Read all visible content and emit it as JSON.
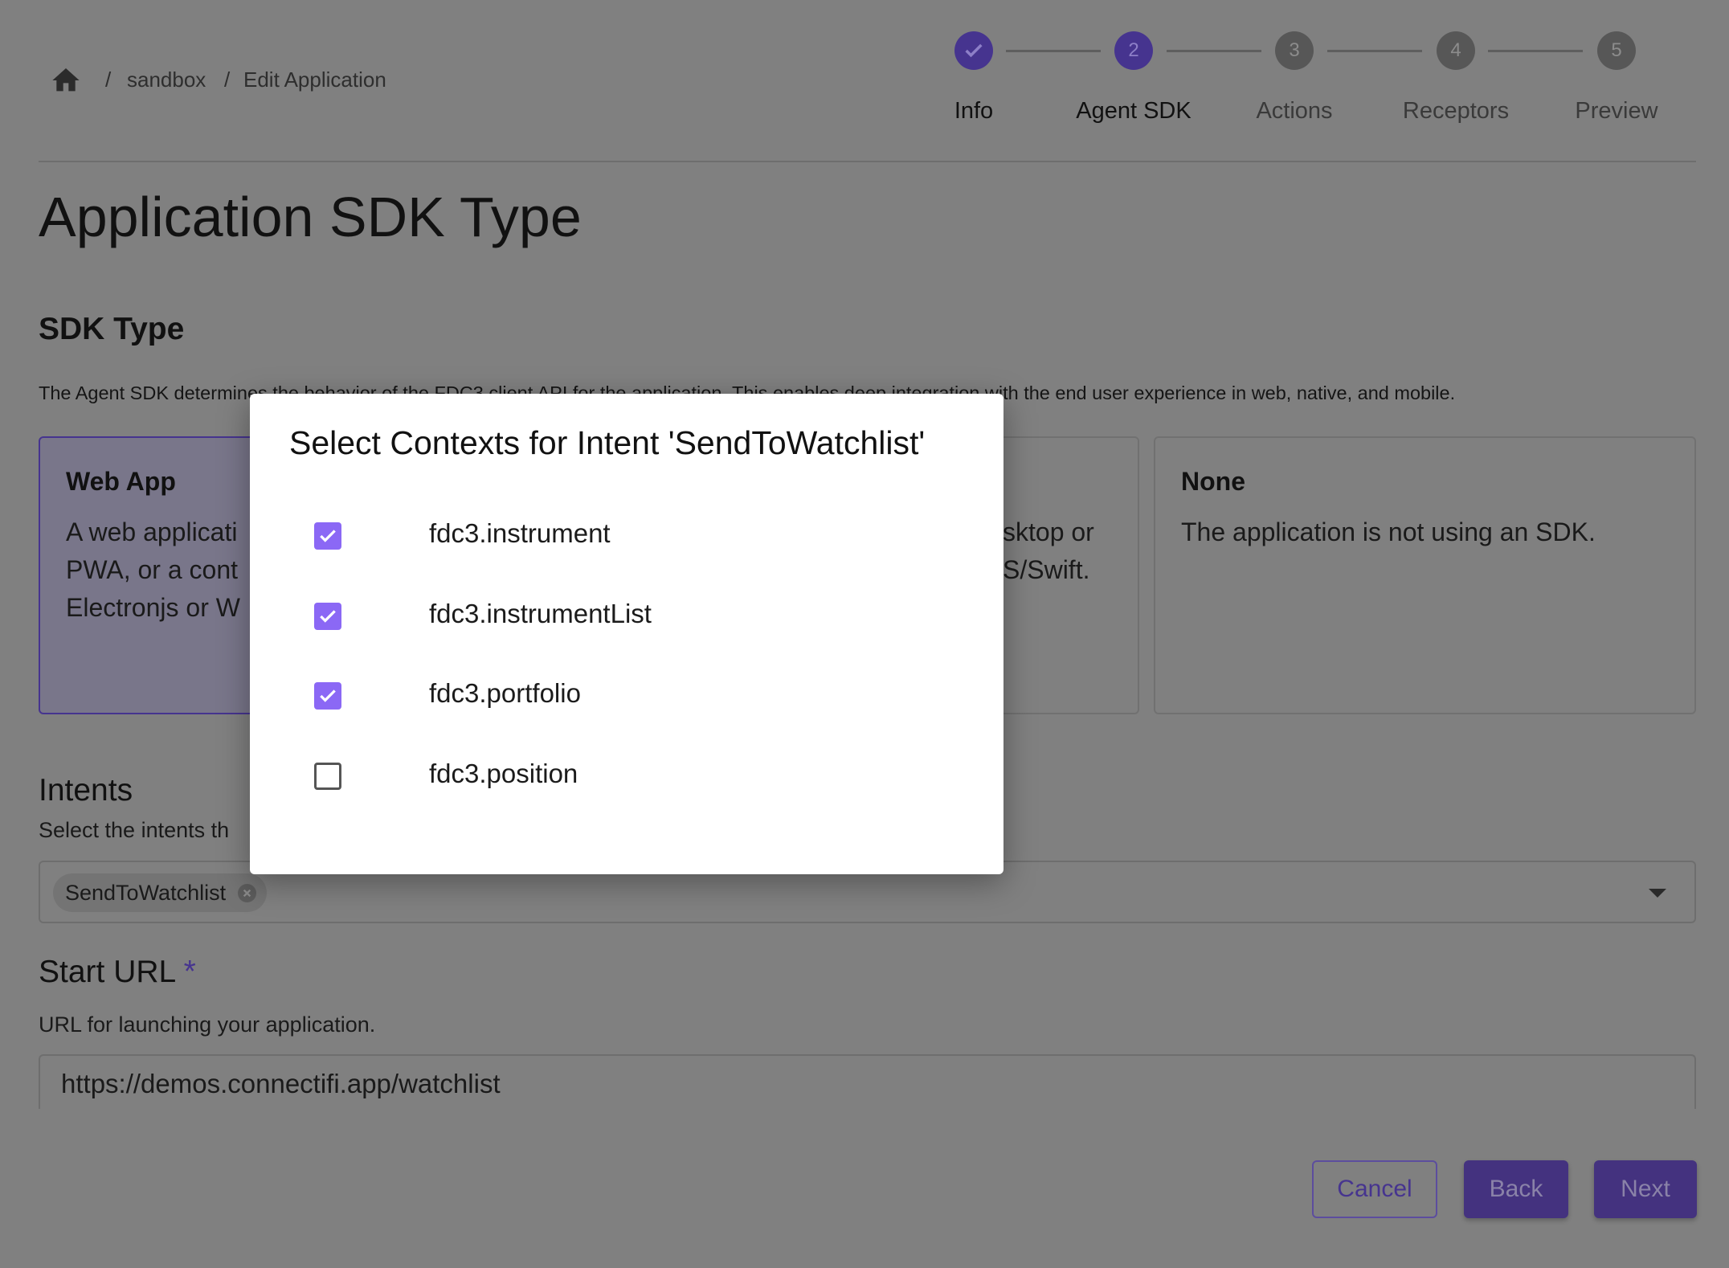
{
  "breadcrumb": {
    "home_icon": "home-icon",
    "items": [
      "sandbox",
      "Edit Application"
    ],
    "separator": "/"
  },
  "stepper": {
    "steps": [
      {
        "number": "1",
        "label": "Info",
        "state": "completed"
      },
      {
        "number": "2",
        "label": "Agent SDK",
        "state": "active"
      },
      {
        "number": "3",
        "label": "Actions",
        "state": "inactive"
      },
      {
        "number": "4",
        "label": "Receptors",
        "state": "inactive"
      },
      {
        "number": "5",
        "label": "Preview",
        "state": "inactive"
      }
    ]
  },
  "page": {
    "title": "Application SDK Type",
    "sdk_heading": "SDK Type",
    "sdk_description": "The Agent SDK determines the behavior of the FDC3 client API for the application. This enables deep integration with the end user experience in web, native, and mobile.",
    "cards": [
      {
        "title": "Web App",
        "lines": [
          "A web applicati",
          "PWA, or a cont",
          "Electronjs or W"
        ],
        "selected": true
      },
      {
        "title": "",
        "lines": [
          "sktop or",
          "S/Swift."
        ],
        "selected": false
      },
      {
        "title": "None",
        "lines": [
          "The application is not using an SDK."
        ],
        "selected": false
      }
    ],
    "intents_heading": "Intents",
    "intents_description": "Select the intents th",
    "intents_selected": [
      "SendToWatchlist"
    ],
    "start_url_label": "Start URL",
    "required_mark": "*",
    "start_url_description": "URL for launching your application.",
    "start_url_value": "https://demos.connectifi.app/watchlist"
  },
  "footer": {
    "cancel": "Cancel",
    "back": "Back",
    "next": "Next"
  },
  "modal": {
    "title": "Select Contexts for Intent 'SendToWatchlist'",
    "options": [
      {
        "label": "fdc3.instrument",
        "checked": true
      },
      {
        "label": "fdc3.instrumentList",
        "checked": true
      },
      {
        "label": "fdc3.portfolio",
        "checked": true
      },
      {
        "label": "fdc3.position",
        "checked": false
      }
    ]
  },
  "colors": {
    "accent": "#8b68f5",
    "accent_dimmed": "#46348f",
    "backdrop": "#808080"
  }
}
